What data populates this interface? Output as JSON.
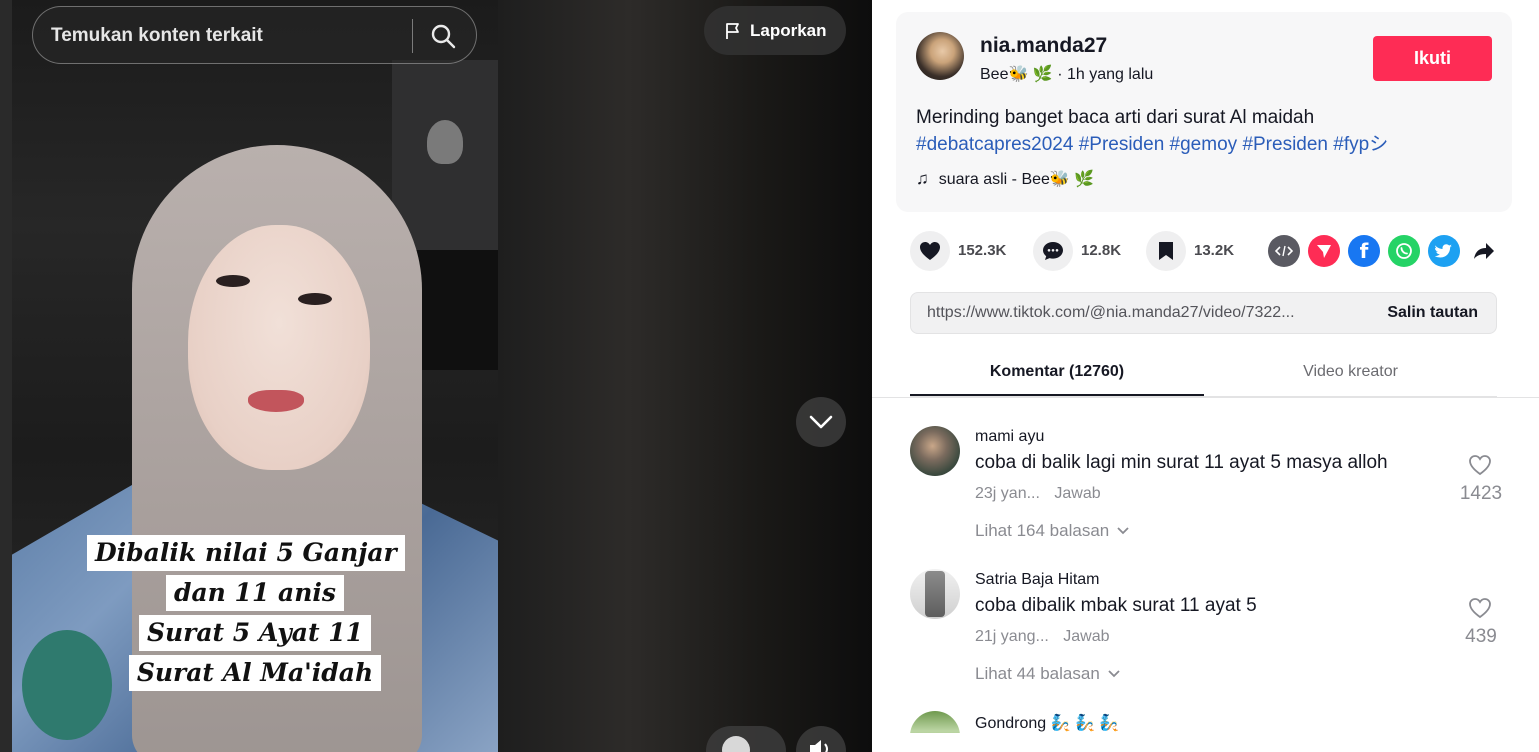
{
  "search": {
    "placeholder": "Temukan konten terkait",
    "icon": "search-icon"
  },
  "video": {
    "report_label": "Laporkan",
    "caption_lines": [
      "Dibalik nilai 5 Ganjar",
      "dan 11 anis",
      "Surat 5 Ayat 11",
      "Surat Al Ma'idah"
    ]
  },
  "author": {
    "username": "nia.manda27",
    "nickname": "Bee🐝 🌿",
    "time": "· 1h yang lalu",
    "follow_label": "Ikuti"
  },
  "post": {
    "description": "Merinding banget baca arti dari surat Al maidah",
    "hashtags": [
      "#debatcapres2024",
      "#Presiden",
      "#gemoy",
      "#Presiden",
      "#fypシ"
    ],
    "music": "suara asli - Bee🐝 🌿"
  },
  "stats": {
    "likes": "152.3K",
    "comments": "12.8K",
    "saves": "13.2K"
  },
  "share": {
    "icons": [
      "embed-icon",
      "send-to-friends-icon",
      "facebook-icon",
      "whatsapp-icon",
      "twitter-icon",
      "share-arrow-icon"
    ],
    "colors": {
      "embed": "#5a5a62",
      "send": "#fe2c55",
      "facebook": "#1877f2",
      "whatsapp": "#25d366",
      "twitter": "#1da1f2"
    }
  },
  "link": {
    "url": "https://www.tiktok.com/@nia.manda27/video/7322...",
    "copy_label": "Salin tautan"
  },
  "tabs": {
    "comments": "Komentar (12760)",
    "creator_videos": "Video kreator"
  },
  "comments": [
    {
      "user": "mami ayu",
      "text": "coba di balik lagi min surat 11 ayat 5 masya alloh",
      "time": "23j yan...",
      "reply_label": "Jawab",
      "likes": "1423",
      "replies_label": "Lihat 164 balasan"
    },
    {
      "user": "Satria Baja Hitam",
      "text": "coba dibalik mbak surat 11 ayat 5",
      "time": "21j yang...",
      "reply_label": "Jawab",
      "likes": "439",
      "replies_label": "Lihat 44 balasan"
    },
    {
      "user": "Gondrong 🧞 🧞 🧞"
    }
  ],
  "colors": {
    "accent": "#fe2c55",
    "hashtag": "#2b5db9",
    "text": "#161823",
    "muted": "#8a8b91"
  }
}
